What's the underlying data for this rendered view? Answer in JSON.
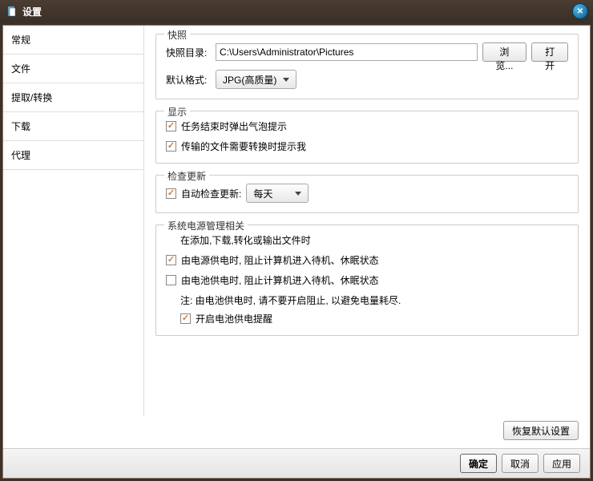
{
  "window": {
    "title": "设置"
  },
  "sidebar": {
    "tabs": [
      {
        "label": "常规"
      },
      {
        "label": "文件"
      },
      {
        "label": "提取/转换"
      },
      {
        "label": "下载"
      },
      {
        "label": "代理"
      }
    ],
    "selected_index": 2
  },
  "snapshot": {
    "legend": "快照",
    "dir_label": "快照目录:",
    "dir_value": "C:\\Users\\Administrator\\Pictures",
    "browse_btn": "浏览...",
    "open_btn": "打开",
    "format_label": "默认格式:",
    "format_value": "JPG(高质量)"
  },
  "display": {
    "legend": "显示",
    "balloon_tip": "任务结束时弹出气泡提示",
    "balloon_checked": true,
    "convert_tip": "传输的文件需要转换时提示我",
    "convert_checked": true
  },
  "update": {
    "legend": "检查更新",
    "auto_label": "自动检查更新:",
    "auto_checked": true,
    "freq_value": "每天"
  },
  "power": {
    "legend": "系统电源管理相关",
    "desc": "在添加,下载,转化或输出文件时",
    "ac_label": "由电源供电时, 阻止计算机进入待机、休眠状态",
    "ac_checked": true,
    "battery_label": "由电池供电时, 阻止计算机进入待机、休眠状态",
    "battery_checked": false,
    "note": "注: 由电池供电时, 请不要开启阻止, 以避免电量耗尽.",
    "remind_label": "开启电池供电提醒",
    "remind_checked": true
  },
  "buttons": {
    "restore": "恢复默认设置",
    "ok": "确定",
    "cancel": "取消",
    "apply": "应用"
  }
}
